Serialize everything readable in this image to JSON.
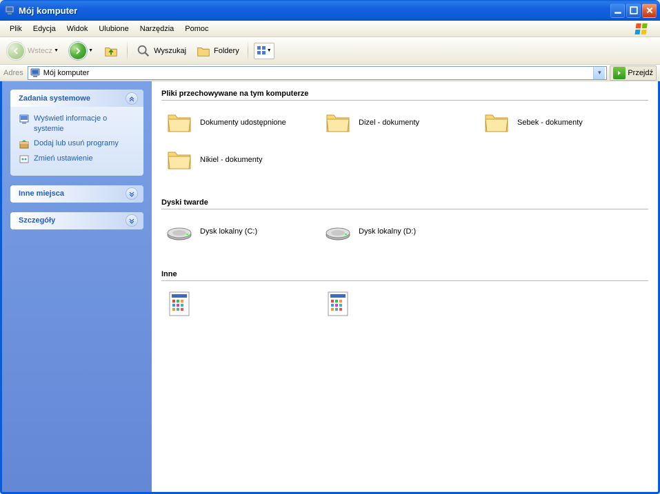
{
  "window": {
    "title": "Mój komputer"
  },
  "menu": {
    "items": [
      "Plik",
      "Edycja",
      "Widok",
      "Ulubione",
      "Narzędzia",
      "Pomoc"
    ]
  },
  "toolbar": {
    "back_label": "Wstecz",
    "search_label": "Wyszukaj",
    "folders_label": "Foldery"
  },
  "address": {
    "label": "Adres",
    "value": "Mój komputer",
    "go_label": "Przejdź"
  },
  "sidebar": {
    "tasks": {
      "header": "Zadania systemowe",
      "links": [
        "Wyświetl informacje o systemie",
        "Dodaj lub usuń programy",
        "Zmień ustawienie"
      ]
    },
    "places": {
      "header": "Inne miejsca"
    },
    "details": {
      "header": "Szczegóły"
    }
  },
  "main": {
    "groups": [
      {
        "header": "Pliki przechowywane na tym komputerze",
        "type": "folder",
        "items": [
          {
            "label": "Dokumenty udostępnione"
          },
          {
            "label": "Dizel - dokumenty"
          },
          {
            "label": "Sebek - dokumenty"
          },
          {
            "label": "Nikiel - dokumenty"
          }
        ]
      },
      {
        "header": "Dyski twarde",
        "type": "disk",
        "items": [
          {
            "label": "Dysk lokalny (C:)"
          },
          {
            "label": "Dysk lokalny (D:)"
          }
        ]
      },
      {
        "header": "Inne",
        "type": "other",
        "items": [
          {
            "label": ""
          },
          {
            "label": ""
          }
        ]
      }
    ]
  }
}
